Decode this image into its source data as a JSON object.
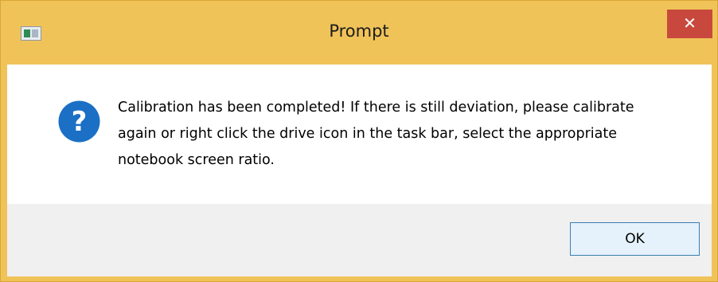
{
  "window": {
    "title": "Prompt",
    "close_label": "✕"
  },
  "dialog": {
    "icon": "question-icon",
    "message": "Calibration has been completed! If there is still deviation, please calibrate again or right click the drive icon in the task bar, select the appropriate notebook screen ratio."
  },
  "buttons": {
    "ok_label": "OK"
  },
  "colors": {
    "titlebar": "#f0c359",
    "close_button": "#c9483e",
    "icon_blue": "#1b6fc4",
    "button_border": "#3c7fb1"
  }
}
